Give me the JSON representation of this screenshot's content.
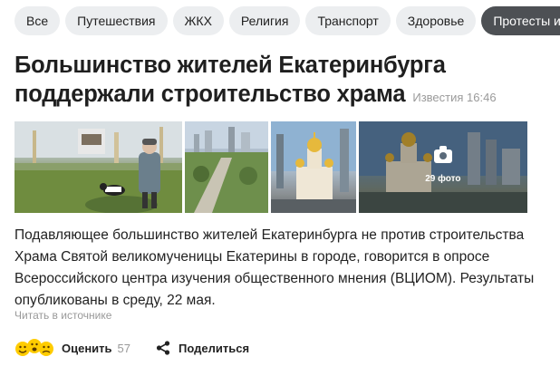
{
  "tabs": [
    "Все",
    "Путешествия",
    "ЖКХ",
    "Религия",
    "Транспорт",
    "Здоровье",
    "Протесты из-за"
  ],
  "active_tab": "Протесты из-за",
  "article": {
    "title": "Большинство жителей Екатеринбурга поддержали строительство храма",
    "source": "Известия",
    "time": "16:46",
    "photo_count": "29 фото",
    "text": "Подавляющее большинство жителей Екатеринбурга не против строительства Храма Святой великомученицы Екатерины в городе, говорится в опросе Всероссийского центра изучения общественного мнения (ВЦИОМ). Результаты опубликованы в среду, 22 мая.",
    "read_source": "Читать в источнике"
  },
  "actions": {
    "rate_label": "Оценить",
    "rate_count": "57",
    "share_label": "Поделиться"
  },
  "icons": {
    "reactions": "reaction-smileys-icon",
    "share": "share-icon",
    "camera": "camera-icon"
  },
  "colors": {
    "active_tab_bg": "#4d5054",
    "tab_bg": "#eceef0",
    "emoji_yellow": "#ffcc00"
  }
}
